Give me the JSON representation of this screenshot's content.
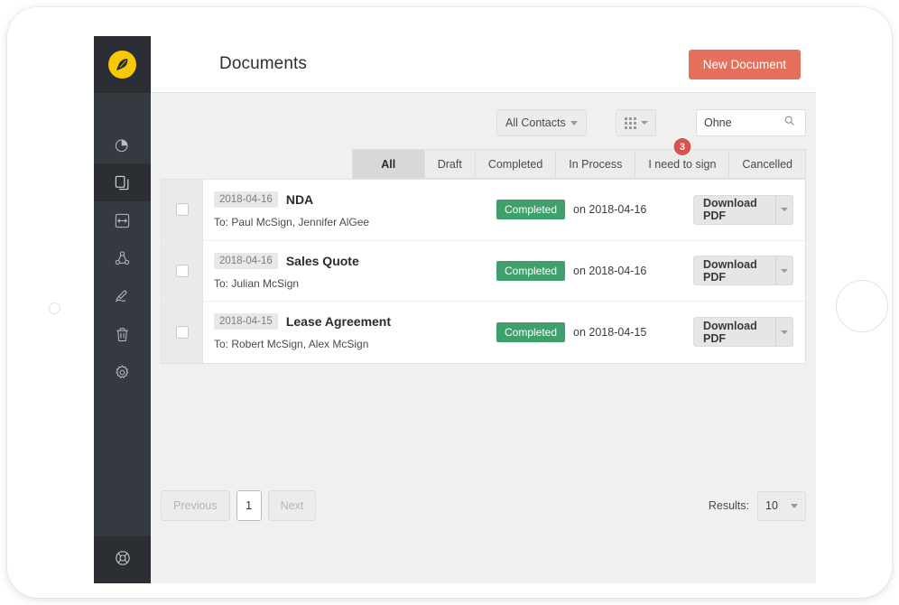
{
  "app": {
    "logo_icon": "feather-quill-icon",
    "logo_color": "#f7c808",
    "sidebar_bg": "#343a40"
  },
  "sidebar": {
    "items": [
      {
        "id": "dashboard",
        "icon": "pie-chart-icon",
        "label": "Dashboard",
        "active": false
      },
      {
        "id": "documents",
        "icon": "documents-icon",
        "label": "Documents",
        "active": true
      },
      {
        "id": "templates",
        "icon": "template-icon",
        "label": "Templates",
        "active": false
      },
      {
        "id": "contacts",
        "icon": "contacts-group-icon",
        "label": "Contacts",
        "active": false
      },
      {
        "id": "signatures",
        "icon": "hand-sign-icon",
        "label": "Signatures",
        "active": false
      },
      {
        "id": "trash",
        "icon": "trash-icon",
        "label": "Trash",
        "active": false
      },
      {
        "id": "settings",
        "icon": "gear-icon",
        "label": "Settings",
        "active": false
      }
    ],
    "help": {
      "id": "help",
      "icon": "lifebuoy-icon",
      "label": "Help"
    }
  },
  "header": {
    "title": "Documents",
    "new_document_label": "New Document",
    "new_document_color": "#e4705b"
  },
  "toolbar": {
    "contacts_filter": {
      "value": "All Contacts",
      "icon": "chevron-down-icon"
    },
    "view_toggle": {
      "icon": "grid-view-icon",
      "caret": "chevron-down-icon"
    },
    "search": {
      "value": "Ohne",
      "placeholder": "Search",
      "icon": "search-icon"
    }
  },
  "tabs": [
    {
      "label": "All",
      "active": true,
      "badge": null
    },
    {
      "label": "Draft",
      "active": false,
      "badge": null
    },
    {
      "label": "Completed",
      "active": false,
      "badge": null
    },
    {
      "label": "In Process",
      "active": false,
      "badge": null
    },
    {
      "label": "I need to sign",
      "active": false,
      "badge": "3"
    },
    {
      "label": "Cancelled",
      "active": false,
      "badge": null
    }
  ],
  "badge_color": "#d9534f",
  "status_color": "#3fa06b",
  "documents": [
    {
      "date": "2018-04-16",
      "name": "NDA",
      "recipients": "To: Paul McSign, Jennifer AlGee",
      "status": "Completed",
      "status_date": "on 2018-04-16",
      "action_label": "Download PDF",
      "action_caret": "chevron-down-icon",
      "checked": false
    },
    {
      "date": "2018-04-16",
      "name": "Sales Quote",
      "recipients": "To: Julian McSign",
      "status": "Completed",
      "status_date": "on 2018-04-16",
      "action_label": "Download PDF",
      "action_caret": "chevron-down-icon",
      "checked": false
    },
    {
      "date": "2018-04-15",
      "name": "Lease Agreement",
      "recipients": "To: Robert McSign, Alex McSign",
      "status": "Completed",
      "status_date": "on 2018-04-15",
      "action_label": "Download PDF",
      "action_caret": "chevron-down-icon",
      "checked": false
    }
  ],
  "pagination": {
    "previous_label": "Previous",
    "previous_disabled": true,
    "current_page": "1",
    "next_label": "Next",
    "next_disabled": true,
    "results_label": "Results:",
    "results_value": "10",
    "results_caret": "chevron-down-icon"
  }
}
